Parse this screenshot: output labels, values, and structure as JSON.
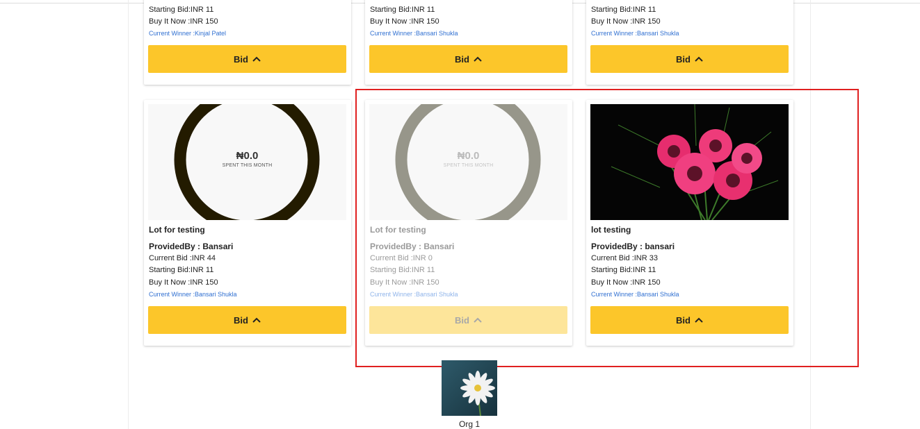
{
  "top_cards": [
    {
      "starting_bid": "Starting Bid:INR 11",
      "buy_now": "Buy It Now :INR 150",
      "winner": "Current Winner :Kinjal Patel",
      "bid_label": "Bid"
    },
    {
      "starting_bid": "Starting Bid:INR 11",
      "buy_now": "Buy It Now :INR 150",
      "winner": "Current Winner :Bansari Shukla",
      "bid_label": "Bid"
    },
    {
      "starting_bid": "Starting Bid:INR 11",
      "buy_now": "Buy It Now :INR 150",
      "winner": "Current Winner :Bansari Shukla",
      "bid_label": "Bid"
    }
  ],
  "lots": [
    {
      "image_amount": "₦0.0",
      "image_caption": "SPENT THIS MONTH",
      "title": "Lot for testing",
      "provided_by": "ProvidedBy : Bansari",
      "current_bid": "Current Bid :INR 44",
      "starting_bid": "Starting Bid:INR 11",
      "buy_now": "Buy It Now :INR 150",
      "winner": "Current Winner :Bansari Shukla",
      "bid_label": "Bid"
    },
    {
      "image_amount": "₦0.0",
      "image_caption": "SPENT THIS MONTH",
      "title": "Lot for testing",
      "provided_by": "ProvidedBy : Bansari",
      "current_bid": "Current Bid :INR 0",
      "starting_bid": "Starting Bid:INR 11",
      "buy_now": "Buy It Now :INR 150",
      "winner": "Current Winner :Bansari Shukla",
      "bid_label": "Bid"
    },
    {
      "title": "lot testing",
      "provided_by": "ProvidedBy : bansari",
      "current_bid": "Current Bid :INR 33",
      "starting_bid": "Starting Bid:INR 11",
      "buy_now": "Buy It Now :INR 150",
      "winner": "Current Winner :Bansari Shukla",
      "bid_label": "Bid"
    }
  ],
  "organization": {
    "name": "Org 1"
  },
  "colors": {
    "bid_button": "#fcc62a",
    "bid_button_disabled": "#fde59a",
    "winner_link": "#2f6fd1",
    "highlight": "#e02020"
  }
}
